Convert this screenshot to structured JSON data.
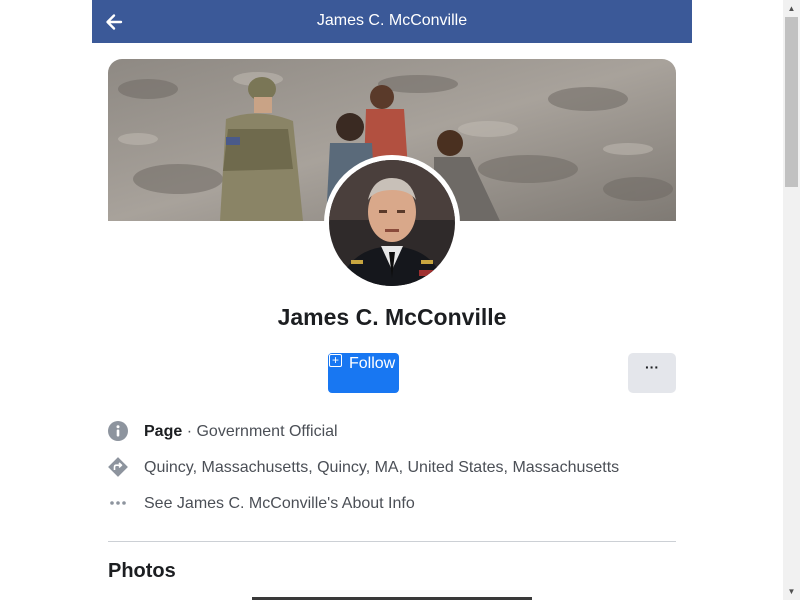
{
  "header": {
    "title": "James C. McConville",
    "back_icon": "back-arrow-icon",
    "background": "#3b5998"
  },
  "profile": {
    "name": "James C. McConville",
    "follow_label": "Follow",
    "follow_icon": "plus-icon",
    "more_label": "···",
    "accent": "#1877f2"
  },
  "info": {
    "category_label": "Page",
    "category_separator": "·",
    "category_value": "Government Official",
    "location": "Quincy, Massachusetts, Quincy, MA, United States, Massachusetts",
    "about_link": "See James C. McConville's About Info"
  },
  "sections": {
    "photos_title": "Photos"
  }
}
